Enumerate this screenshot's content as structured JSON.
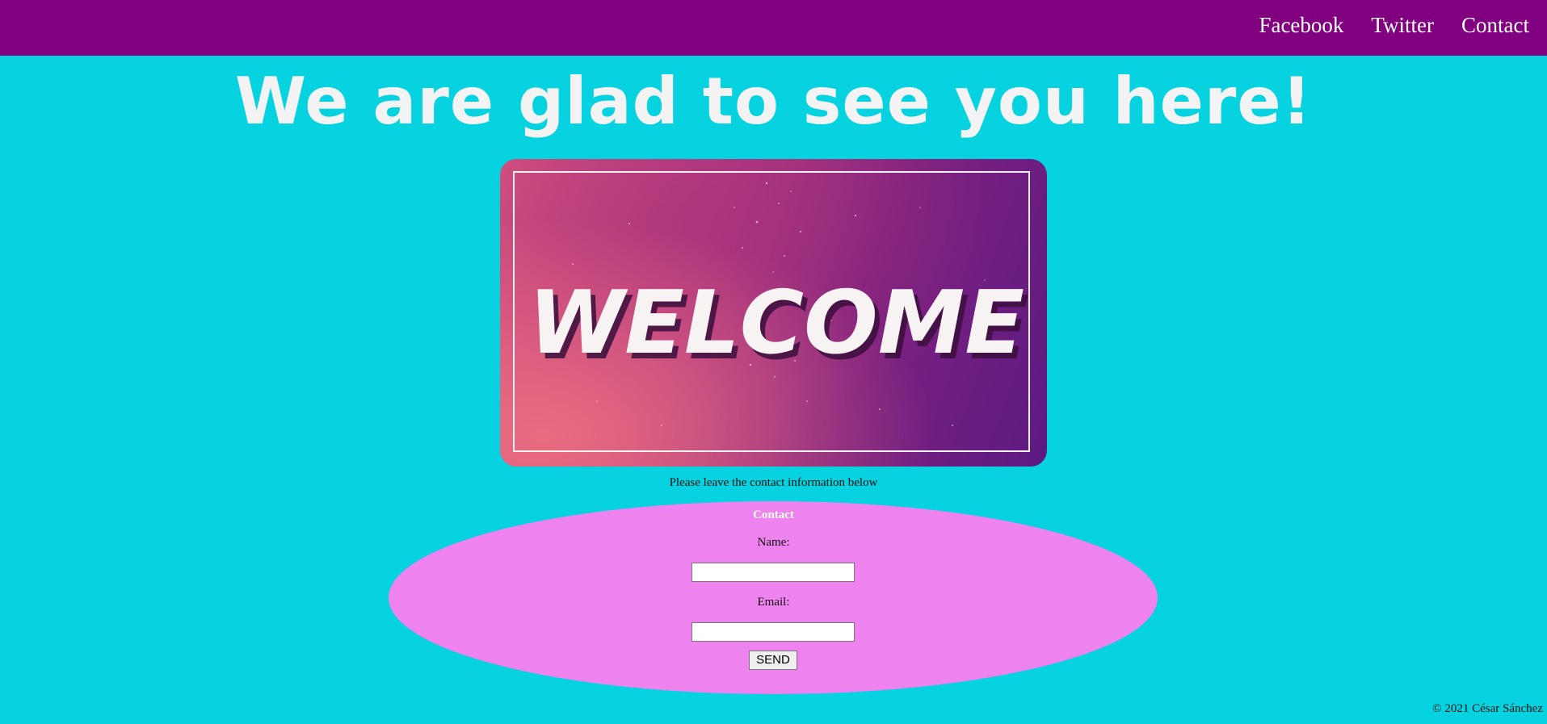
{
  "nav": {
    "links": [
      "Facebook",
      "Twitter",
      "Contact"
    ]
  },
  "headline": "We are glad to see you here!",
  "hero_image": {
    "text": "WELCOME",
    "gradient_colors": [
      "#ec6e80",
      "#b23a82",
      "#5c1a82"
    ]
  },
  "caption": "Please leave the contact information below",
  "form": {
    "title": "Contact",
    "name_label": "Name:",
    "name_value": "",
    "email_label": "Email:",
    "email_value": "",
    "submit_label": "SEND"
  },
  "footer": "© 2021 César Sánchez",
  "colors": {
    "nav_bg": "#80007f",
    "page_bg": "#06d2e0",
    "form_bg": "#ee82ee",
    "headline": "#f3f3f3"
  }
}
